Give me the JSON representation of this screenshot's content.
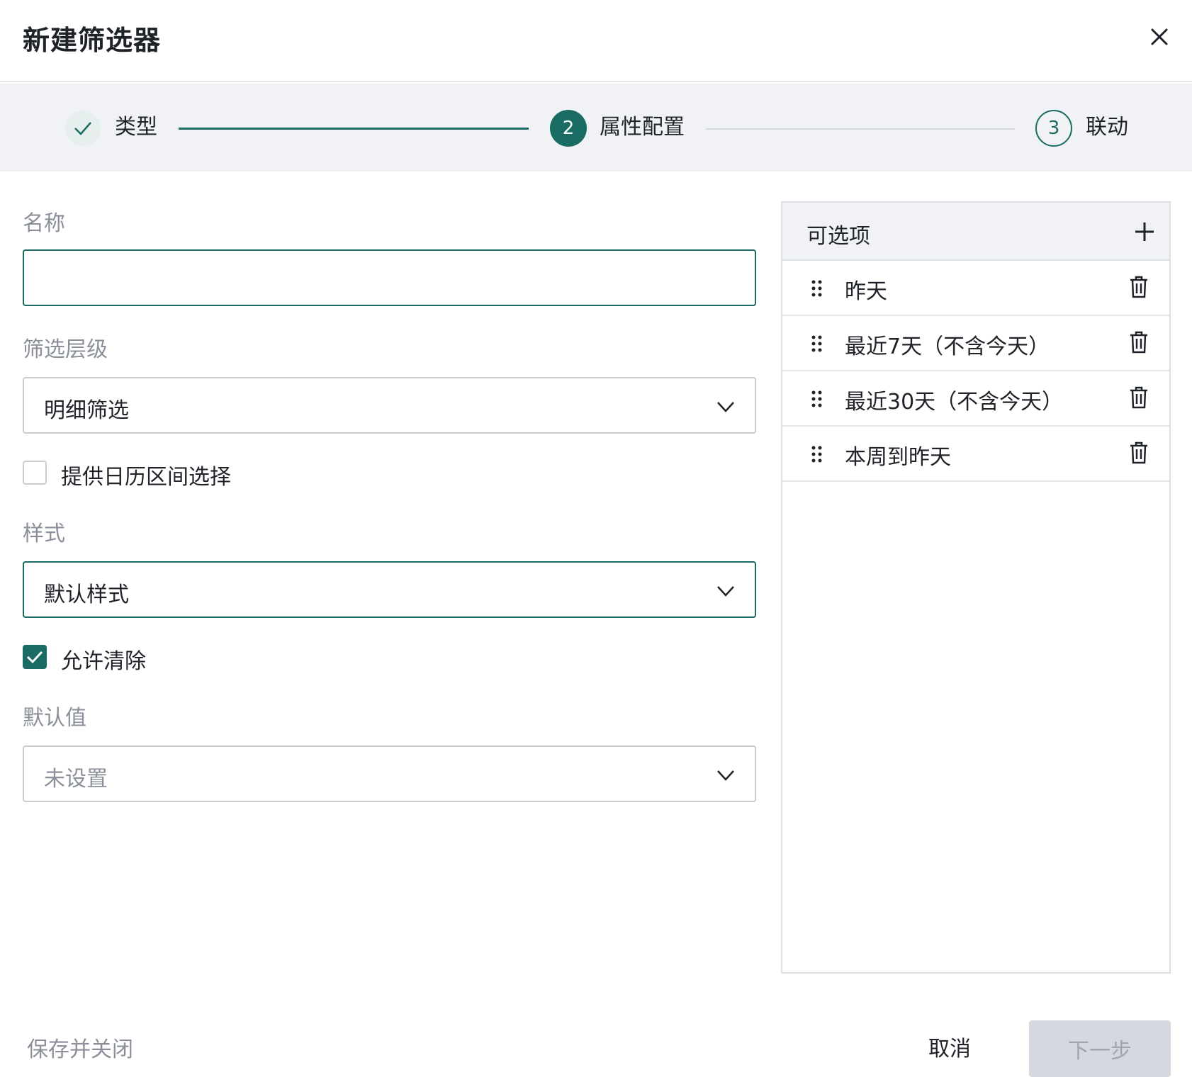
{
  "dialog": {
    "title": "新建筛选器",
    "close_icon": "close-icon"
  },
  "steps": [
    {
      "label": "类型",
      "state": "done",
      "icon": "check-icon"
    },
    {
      "label": "属性配置",
      "number": "2",
      "state": "active"
    },
    {
      "label": "联动",
      "number": "3",
      "state": "pending"
    }
  ],
  "form": {
    "name": {
      "label": "名称",
      "value": "",
      "placeholder": ""
    },
    "filter_level": {
      "label": "筛选层级",
      "value": "明细筛选"
    },
    "calendar_range": {
      "label": "提供日历区间选择",
      "checked": false
    },
    "style": {
      "label": "样式",
      "value": "默认样式"
    },
    "allow_clear": {
      "label": "允许清除",
      "checked": true
    },
    "default_value": {
      "label": "默认值",
      "value": "未设置"
    }
  },
  "options": {
    "title": "可选项",
    "add_icon": "plus-icon",
    "items": [
      {
        "label": "昨天"
      },
      {
        "label": "最近7天（不含今天）"
      },
      {
        "label": "最近30天（不含今天）"
      },
      {
        "label": "本周到昨天"
      }
    ]
  },
  "footer": {
    "save_close": "保存并关闭",
    "cancel": "取消",
    "next": "下一步"
  },
  "colors": {
    "accent": "#1a6b63",
    "disabled_bg": "#d5d9df",
    "panel_bg": "#f0f2f5"
  }
}
